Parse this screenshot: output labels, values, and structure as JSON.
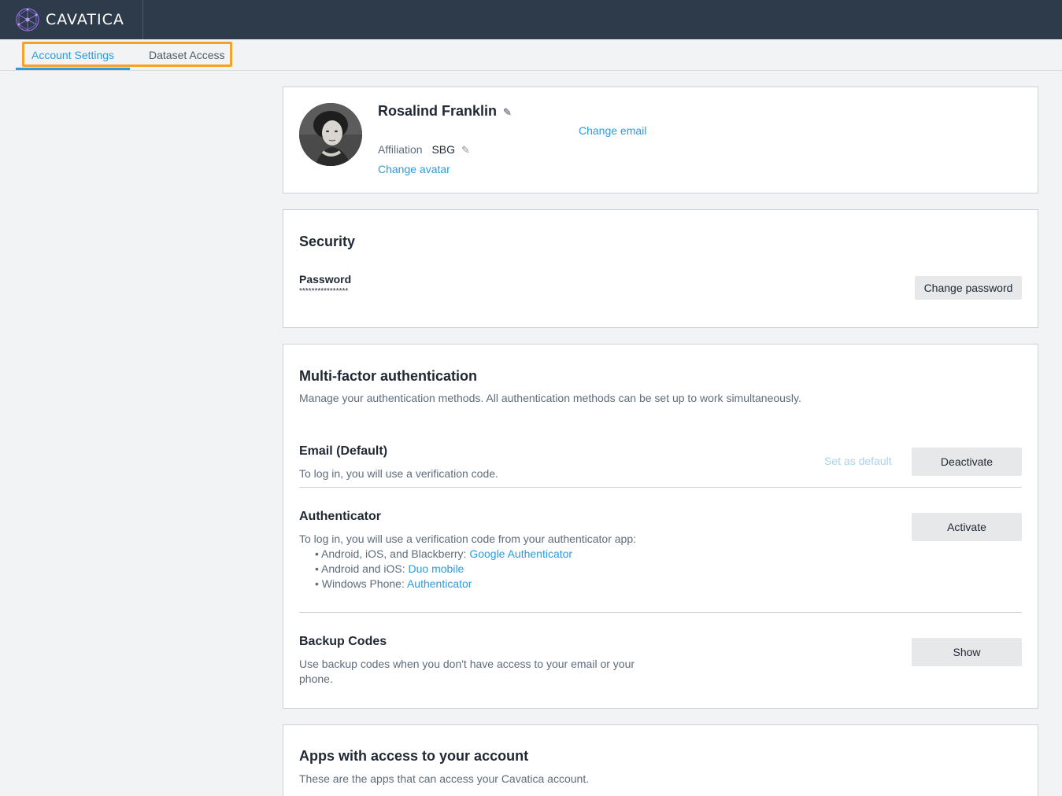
{
  "app": {
    "name": "CAVATICA",
    "logo_icon": "network-globe-icon"
  },
  "tabs": [
    {
      "label": "Account Settings",
      "active": true
    },
    {
      "label": "Dataset Access",
      "active": false
    }
  ],
  "profile": {
    "name": "Rosalind Franklin",
    "affiliation_label": "Affiliation",
    "affiliation_value": "SBG",
    "change_avatar": "Change avatar",
    "change_email": "Change email"
  },
  "security": {
    "title": "Security",
    "password_label": "Password",
    "password_mask": "****************",
    "change_password": "Change password"
  },
  "mfa": {
    "title": "Multi-factor authentication",
    "description": "Manage your authentication methods. All authentication methods can be set up to work simultaneously.",
    "email": {
      "title": "Email (Default)",
      "description": "To log in, you will use a verification code.",
      "set_default": "Set as default",
      "button": "Deactivate"
    },
    "authenticator": {
      "title": "Authenticator",
      "description": "To log in, you will use a verification code from your authenticator app:",
      "items": [
        {
          "prefix": "• Android, iOS, and Blackberry: ",
          "link": "Google Authenticator"
        },
        {
          "prefix": "• Android and iOS: ",
          "link": "Duo mobile"
        },
        {
          "prefix": "• Windows Phone: ",
          "link": "Authenticator"
        }
      ],
      "button": "Activate"
    },
    "backup": {
      "title": "Backup Codes",
      "description_line1": "Use backup codes when you don't have access to your email or your",
      "description_line2": "phone.",
      "button": "Show"
    }
  },
  "apps": {
    "title": "Apps with access to your account",
    "description": "These are the apps that can access your Cavatica account."
  },
  "colors": {
    "accent": "#2d9be0",
    "topbar": "#2e3b4b",
    "highlight": "#f7a02a"
  }
}
